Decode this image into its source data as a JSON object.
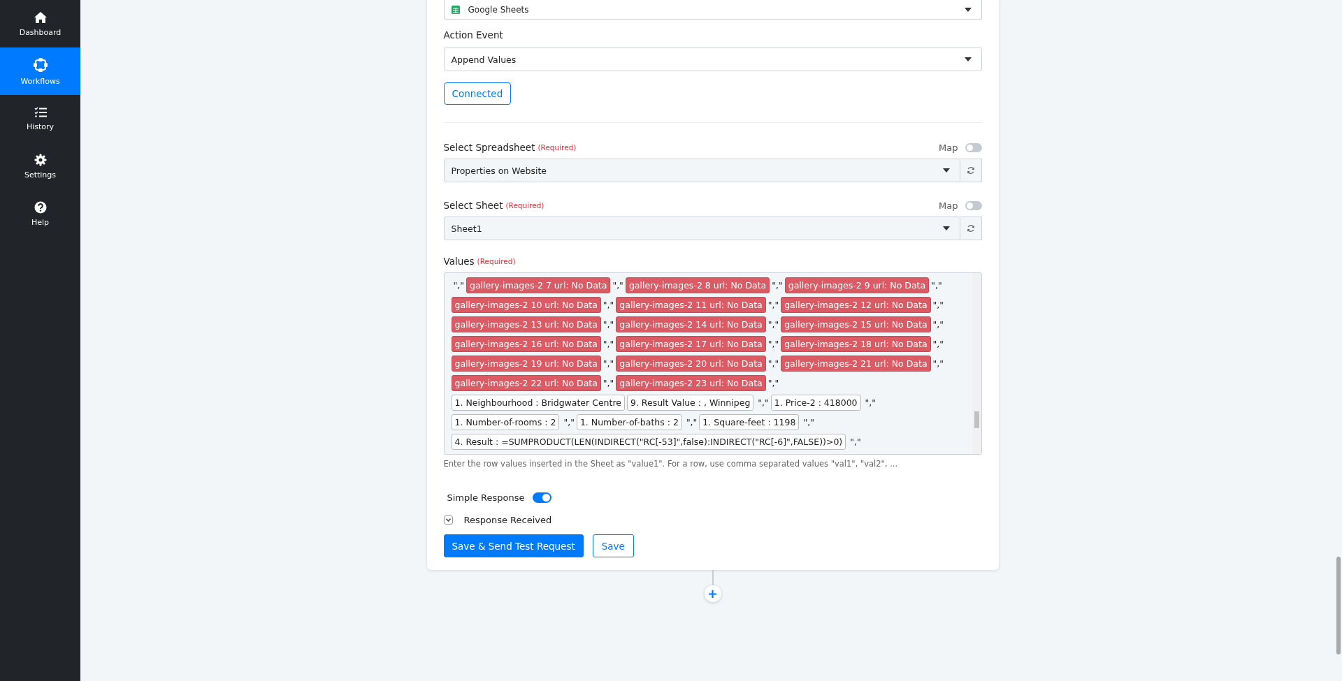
{
  "sidebar": {
    "items": [
      {
        "label": "Dashboard",
        "selected": false
      },
      {
        "label": "Workflows",
        "selected": true
      },
      {
        "label": "History",
        "selected": false
      },
      {
        "label": "Settings",
        "selected": false
      },
      {
        "label": "Help",
        "selected": false
      }
    ]
  },
  "app_select": {
    "value": "Google Sheets"
  },
  "action_event": {
    "label": "Action Event",
    "value": "Append Values"
  },
  "connection_button": "Connected",
  "fields": [
    {
      "label": "Select Spreadsheet",
      "required": "(Required)",
      "map_label": "Map",
      "map_on": false,
      "value": "Properties on Website"
    },
    {
      "label": "Select Sheet",
      "required": "(Required)",
      "map_label": "Map",
      "map_on": false,
      "value": "Sheet1"
    }
  ],
  "values": {
    "label": "Values",
    "required": "(Required)",
    "lines": [
      [
        {
          "kind": "sep",
          "text": "\",\""
        },
        {
          "kind": "error",
          "text": "gallery-images-2 7 url: No Data"
        },
        {
          "kind": "sep",
          "text": "\",\""
        },
        {
          "kind": "error",
          "text": "gallery-images-2 8 url: No Data"
        },
        {
          "kind": "sep",
          "text": "\",\""
        },
        {
          "kind": "error",
          "text": "gallery-images-2 9 url: No Data"
        },
        {
          "kind": "sep",
          "text": "\",\""
        }
      ],
      [
        {
          "kind": "error",
          "text": "gallery-images-2 10 url: No Data"
        },
        {
          "kind": "sep",
          "text": "\",\""
        },
        {
          "kind": "error",
          "text": "gallery-images-2 11 url: No Data"
        },
        {
          "kind": "sep",
          "text": "\",\""
        },
        {
          "kind": "error",
          "text": "gallery-images-2 12 url: No Data"
        },
        {
          "kind": "sep",
          "text": "\",\""
        }
      ],
      [
        {
          "kind": "error",
          "text": "gallery-images-2 13 url: No Data"
        },
        {
          "kind": "sep",
          "text": "\",\""
        },
        {
          "kind": "error",
          "text": "gallery-images-2 14 url: No Data"
        },
        {
          "kind": "sep",
          "text": "\",\""
        },
        {
          "kind": "error",
          "text": "gallery-images-2 15 url: No Data"
        },
        {
          "kind": "sep",
          "text": "\",\""
        }
      ],
      [
        {
          "kind": "error",
          "text": "gallery-images-2 16 url: No Data"
        },
        {
          "kind": "sep",
          "text": "\",\""
        },
        {
          "kind": "error",
          "text": "gallery-images-2 17 url: No Data"
        },
        {
          "kind": "sep",
          "text": "\",\""
        },
        {
          "kind": "error",
          "text": "gallery-images-2 18 url: No Data"
        },
        {
          "kind": "sep",
          "text": "\",\""
        }
      ],
      [
        {
          "kind": "error",
          "text": "gallery-images-2 19 url: No Data"
        },
        {
          "kind": "sep",
          "text": "\",\""
        },
        {
          "kind": "error",
          "text": "gallery-images-2 20 url: No Data"
        },
        {
          "kind": "sep",
          "text": "\",\""
        },
        {
          "kind": "error",
          "text": "gallery-images-2 21 url: No Data"
        },
        {
          "kind": "sep",
          "text": "\",\""
        }
      ],
      [
        {
          "kind": "error",
          "text": "gallery-images-2 22 url: No Data"
        },
        {
          "kind": "sep",
          "text": "\",\""
        },
        {
          "kind": "error",
          "text": "gallery-images-2 23 url: No Data"
        },
        {
          "kind": "sep",
          "text": "\",\""
        }
      ],
      [
        {
          "kind": "field",
          "text": "1. Neighbourhood : Bridgwater Centre"
        },
        {
          "kind": "field",
          "text": "9. Result Value : , Winnipeg"
        },
        {
          "kind": "sep",
          "text": "\",\""
        },
        {
          "kind": "field",
          "text": "1. Price-2 : 418000"
        },
        {
          "kind": "sep",
          "text": "\",\""
        }
      ],
      [
        {
          "kind": "field",
          "text": "1. Number-of-rooms : 2"
        },
        {
          "kind": "sep",
          "text": "\",\""
        },
        {
          "kind": "field",
          "text": "1. Number-of-baths : 2"
        },
        {
          "kind": "sep",
          "text": "\",\""
        },
        {
          "kind": "field",
          "text": "1. Square-feet : 1198"
        },
        {
          "kind": "sep",
          "text": "\",\""
        }
      ],
      [
        {
          "kind": "field",
          "text": "4. Result : =SUMPRODUCT(LEN(INDIRECT(\"RC[-53]\",false):INDIRECT(\"RC[-6]\",FALSE))>0)"
        },
        {
          "kind": "sep",
          "text": "\",\""
        }
      ]
    ],
    "hint": "Enter the row values inserted in the Sheet as \"value1\". For a row, use comma separated values \"val1\", \"val2\", ..."
  },
  "simple_response": {
    "label": "Simple Response",
    "on": true
  },
  "response_received": {
    "label": "Response Received",
    "expanded": false
  },
  "buttons": [
    {
      "label": "Save & Send Test Request",
      "kind": "primary"
    },
    {
      "label": "Save",
      "kind": "outline"
    }
  ]
}
